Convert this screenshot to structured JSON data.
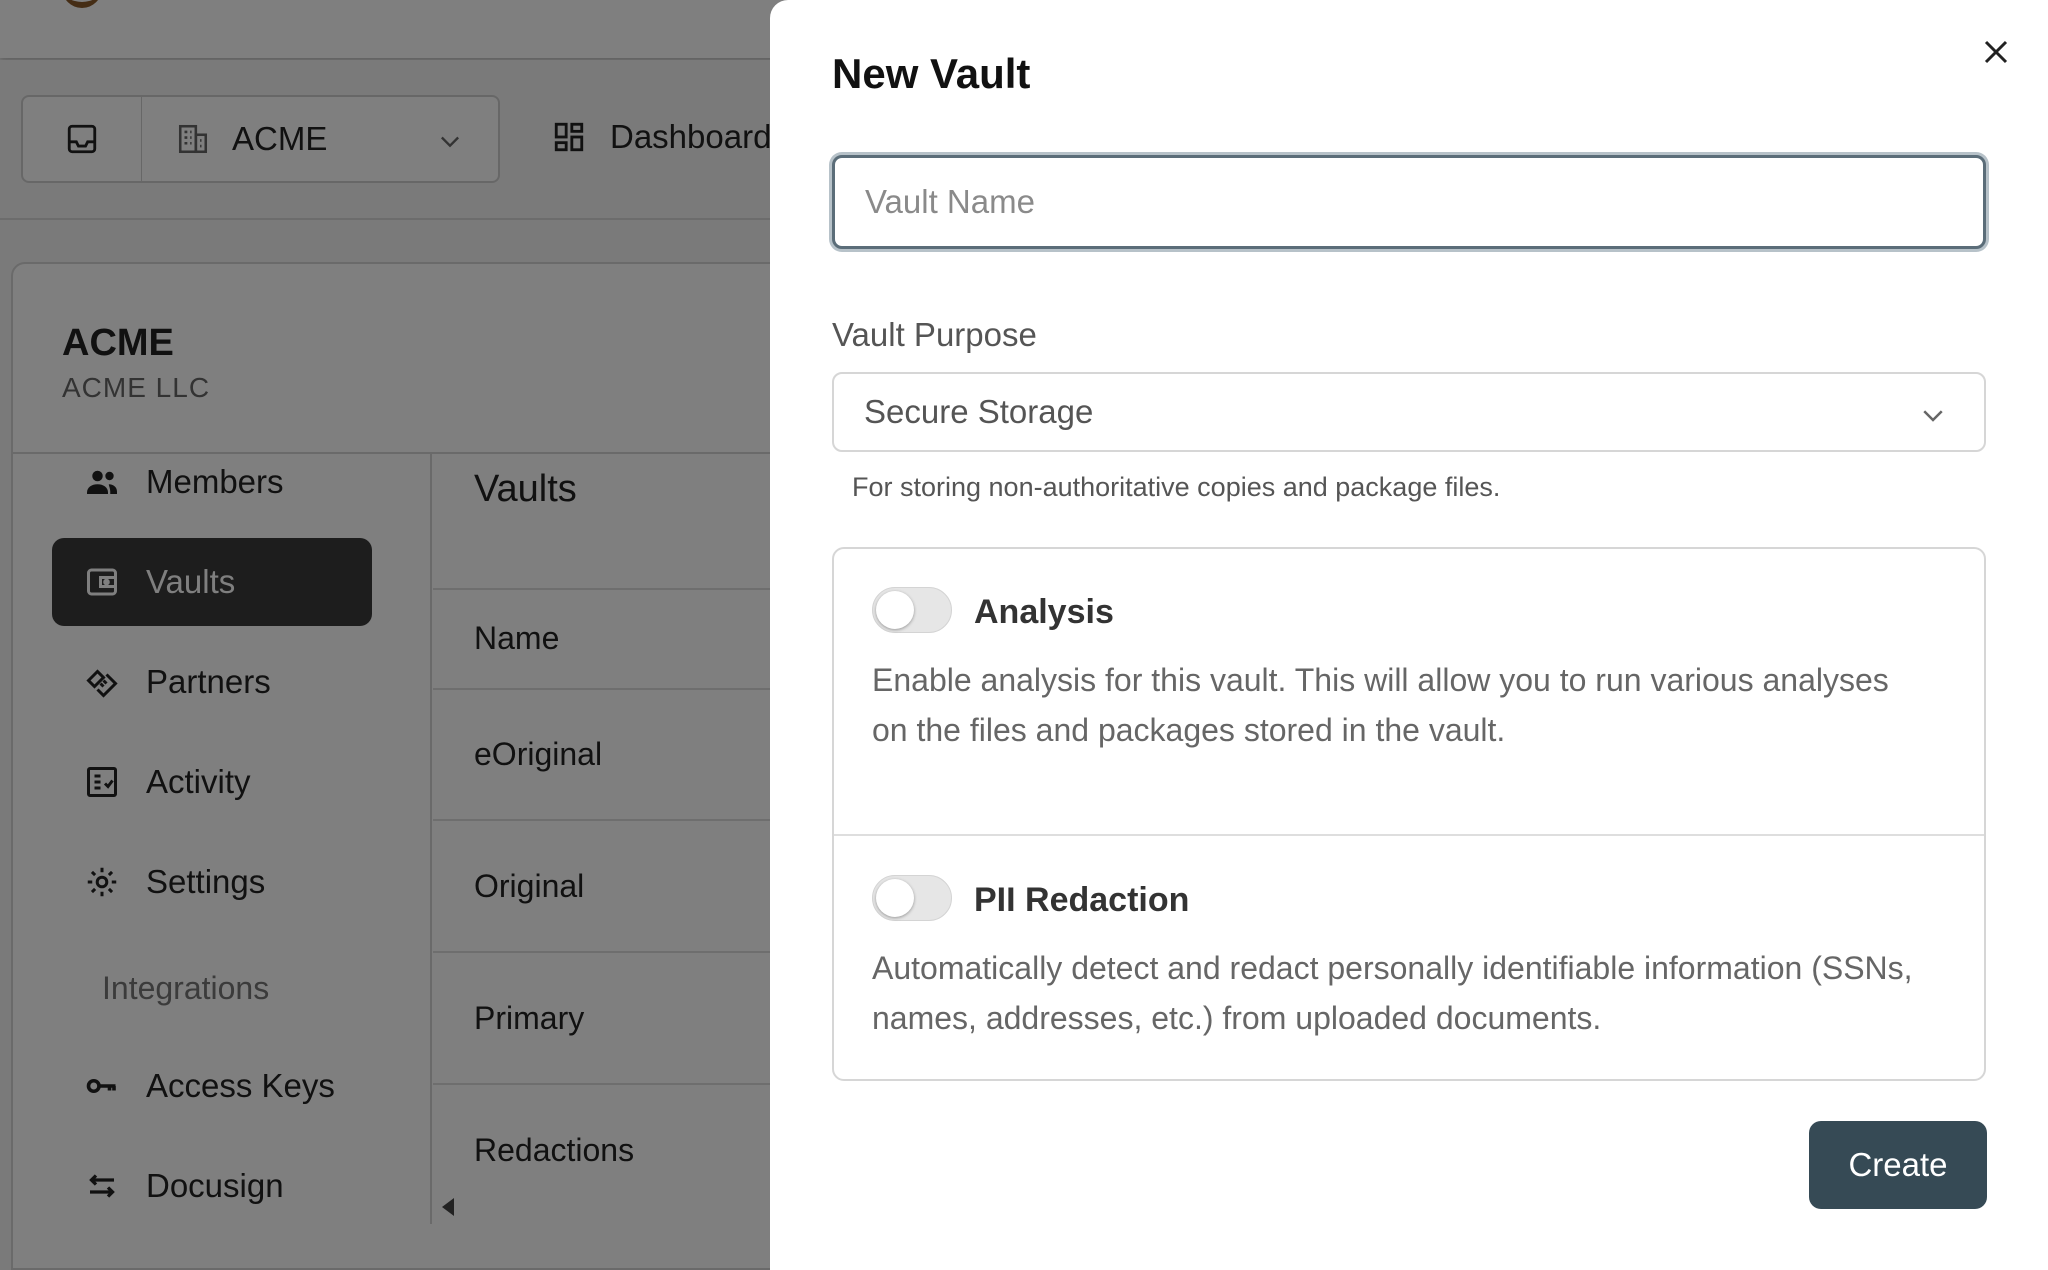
{
  "background": {
    "org_selector": {
      "value": "ACME"
    },
    "nav": {
      "dashboard_label": "Dashboard"
    },
    "org": {
      "name": "ACME",
      "legal_name": "ACME LLC"
    },
    "sidebar": {
      "items": [
        {
          "label": "Members",
          "icon": "members-icon"
        },
        {
          "label": "Vaults",
          "icon": "vault-icon",
          "active": true
        },
        {
          "label": "Partners",
          "icon": "handshake-icon"
        },
        {
          "label": "Activity",
          "icon": "activity-icon"
        },
        {
          "label": "Settings",
          "icon": "gear-icon"
        }
      ],
      "section_integrations": "Integrations",
      "integration_items": [
        {
          "label": "Access Keys",
          "icon": "key-icon"
        },
        {
          "label": "Docusign",
          "icon": "swap-arrows-icon"
        }
      ]
    },
    "vaults": {
      "title": "Vaults",
      "column_name": "Name",
      "rows": [
        "eOriginal",
        "Original",
        "Primary",
        "Redactions"
      ]
    }
  },
  "drawer": {
    "title": "New Vault",
    "name_placeholder": "Vault Name",
    "purpose_label": "Vault Purpose",
    "purpose_value": "Secure Storage",
    "purpose_help": "For storing non-authoritative copies and package files.",
    "features": [
      {
        "title": "Analysis",
        "description": "Enable analysis for this vault. This will allow you to run various analyses on the files and packages stored in the vault.",
        "enabled": false
      },
      {
        "title": "PII Redaction",
        "description": "Automatically detect and redact personally identifiable information (SSNs, names, addresses, etc.) from uploaded documents.",
        "enabled": false
      }
    ],
    "create_label": "Create"
  },
  "colors": {
    "primary_button": "#364a55",
    "active_nav": "#3a3a3a",
    "overlay": "rgba(0,0,0,0.5)"
  }
}
